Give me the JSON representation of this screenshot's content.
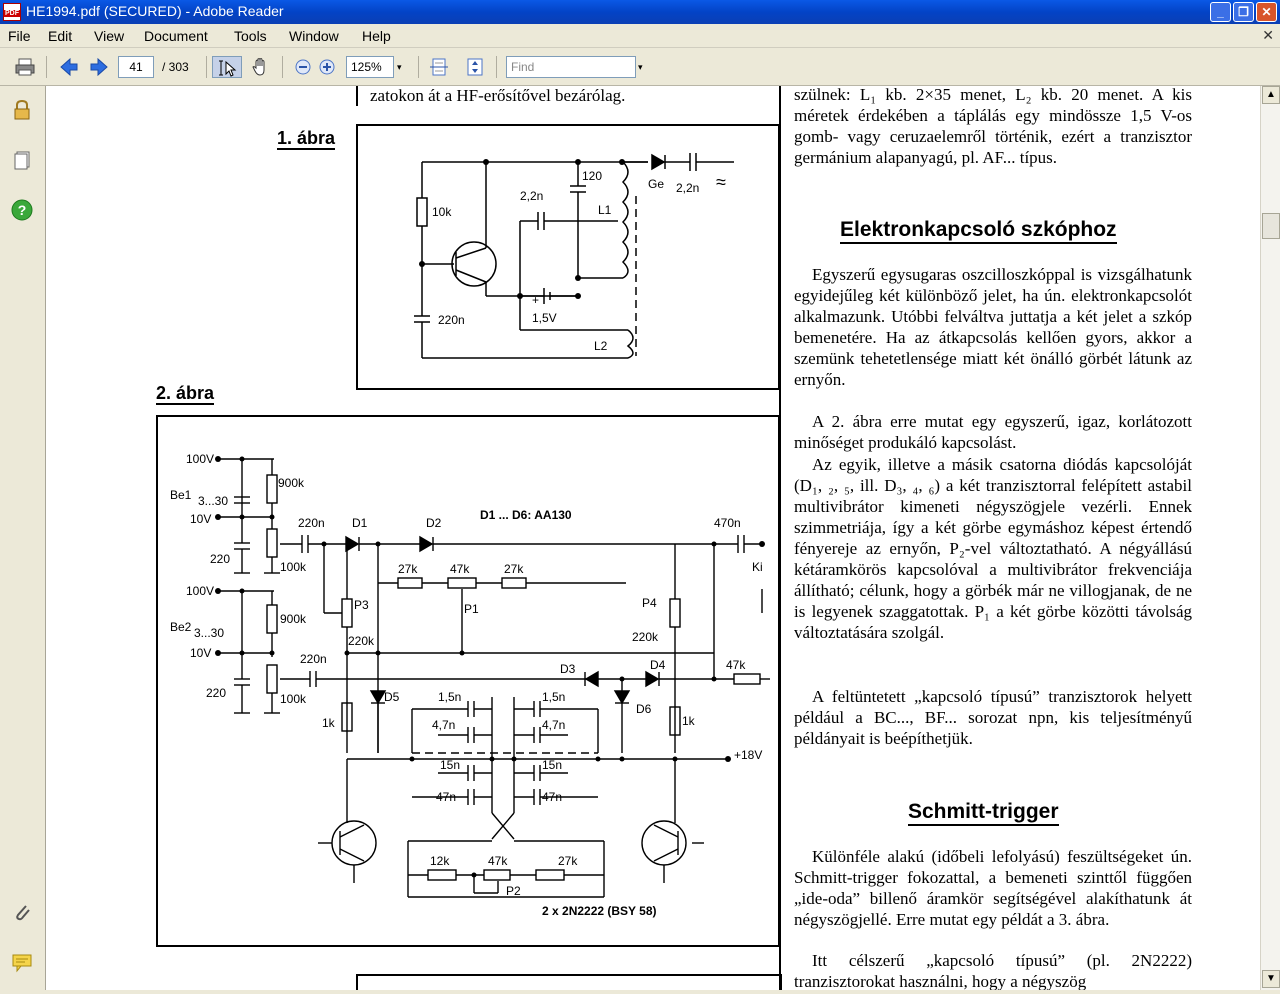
{
  "window": {
    "title": "HE1994.pdf (SECURED) - Adobe Reader",
    "controls": [
      "_",
      "❐",
      "✕"
    ]
  },
  "menu": {
    "items": [
      "File",
      "Edit",
      "View",
      "Document",
      "Tools",
      "Window",
      "Help"
    ],
    "close_glyph": "✕"
  },
  "toolbar": {
    "page_current": "41",
    "page_total": "/ 303",
    "zoom": "125%",
    "find_placeholder": "Find"
  },
  "page": {
    "top_left_line": "zatokon át a HF-erősítővel bezárólag.",
    "fig1_label": "1. ábra",
    "fig2_label": "2. ábra",
    "fig1": {
      "labels": [
        "10k",
        "120",
        "2,2n",
        "L1",
        "Ge",
        "2,2n",
        "≈",
        "220n",
        "+",
        "1,5V",
        "L2"
      ]
    },
    "fig2": {
      "labels": [
        "100V",
        "Be1",
        "3...30",
        "10V",
        "220",
        "900k",
        "220n",
        "D1",
        "D2",
        "D1 ... D6: AA130",
        "470n",
        "Ki",
        "100k",
        "27k",
        "47k",
        "27k",
        "P3",
        "P1",
        "P4",
        "220k",
        "220k",
        "100V",
        "Be2",
        "900k",
        "10V",
        "220n",
        "D3",
        "D4",
        "47k",
        "220",
        "100k",
        "D5",
        "D6",
        "1k",
        "1,5n",
        "1,5n",
        "4,7n",
        "4,7n",
        "1k",
        "+18V",
        "15n",
        "15n",
        "47n",
        "47n",
        "12k",
        "47k",
        "27k",
        "P2",
        "2 x 2N2222 (BSY 58)",
        "3...30"
      ]
    },
    "right_column": {
      "intro": "szülnek: L₁ kb. 2×35 menet, L₂ kb. 20 menet. A kis méretek érdekében a táplálás egy mindössze 1,5 V-os gomb- vagy ceruzaelemről történik, ezért a tranzisztor germánium alapanyagú, pl. AF... típus.",
      "heading1": "Elektronkapcsoló szkóphoz",
      "para1": "Egyszerű egysugaras oszcilloszkóppal is vizsgálhatunk egyidejűleg két különböző jelet, ha ún. elektronkapcsolót alkalmazunk. Utóbbi felváltva juttatja a két jelet a szkóp bemenetére. Ha az átkapcsolás kellően gyors, akkor a szemünk tehetetlensége miatt két önálló görbét látunk az ernyőn.",
      "para2": "A 2. ábra erre mutat egy egyszerű, igaz, korlátozott minőséget produkáló kapcsolást.",
      "para3": "Az egyik, illetve a másik csatorna diódás kapcsolóját (D₁, ₂, ₅, ill. D₃, ₄, ₆) a két tranzisztorral felépített astabil multivibrátor kimeneti négyszögjele vezérli. Ennek szimmetriája, így a két görbe egymáshoz képest értendő fényereje az ernyőn, P₂-vel változtatható. A négyállású kétáramkörös kapcsolóval a multivibrátor frekvenciája állítható; célunk, hogy a görbék már ne villogjanak, de ne is legyenek szaggatottak. P₁ a két görbe közötti távolság változtatására szolgál.",
      "para4": "A feltüntetett „kapcsoló típusú” tranzisztorok helyett például a BC..., BF... sorozat npn, kis teljesítményű példányait is beépíthetjük.",
      "heading2": "Schmitt-trigger",
      "para5": "Különféle alakú (időbeli lefolyású) feszültségeket ún. Schmitt-trigger fokozattal, a bemeneti szinttől függően „ide-oda” billenő áramkör segítségével alakíthatunk át négyszögjellé. Erre mutat egy példát a 3. ábra.",
      "para6": "Itt célszerű „kapcsoló típusú” (pl. 2N2222) tranzisztorokat használni, hogy a négyszög"
    }
  }
}
